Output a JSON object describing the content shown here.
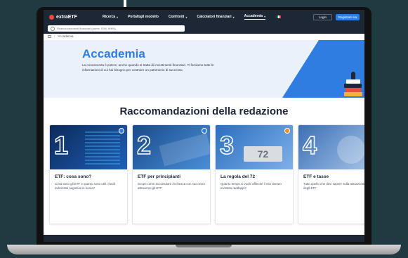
{
  "nav": {
    "logo": "extraETF",
    "items": [
      {
        "label": "Ricerca",
        "active": false
      },
      {
        "label": "Portafogli modello",
        "active": false
      },
      {
        "label": "Confronti",
        "active": false
      },
      {
        "label": "Calcolatori finanziari",
        "active": false
      },
      {
        "label": "Accademia",
        "active": true
      }
    ],
    "login": "Login",
    "register": "Registrati ora",
    "colors": {
      "bg": "#1d2736",
      "accent": "#2f7de1",
      "logo_dot": "#e94b3c"
    }
  },
  "search": {
    "placeholder": "Ricerca strumenti finanziari (nome, ISIN, WKN)",
    "value": ""
  },
  "breadcrumb": {
    "current": "Accademia"
  },
  "hero": {
    "title": "Accademia",
    "description": "La conoscenza è potere, anche quando si tratta di investimenti finanziari. Ti forniamo tutte le informazioni di cui hai bisogno per costruire un patrimonio di successo."
  },
  "section": {
    "title": "Raccomandazioni della redazione"
  },
  "cards": [
    {
      "number": "1",
      "title": "ETF: cosa sono?",
      "description": "Cosa sono gli ETF e quanto sono utili i fondi indicizzati negoziati in borsa?",
      "badge_color": "#2f7de1"
    },
    {
      "number": "2",
      "title": "ETF per principianti",
      "description": "Scopri come accumulare ricchezza con successo attraverso gli ETF",
      "badge_color": "#2f7de1"
    },
    {
      "number": "3",
      "title": "La regola del 72",
      "description": "Quanto tempo ci vuole affinché il mio denaro investito raddoppi?",
      "badge_color": "#f08a24"
    },
    {
      "number": "4",
      "title": "ETF e tasse",
      "description": "Tutto quello che devi sapere sulla tassazione degli ETF",
      "badge_color": "#8a4fd6"
    }
  ]
}
